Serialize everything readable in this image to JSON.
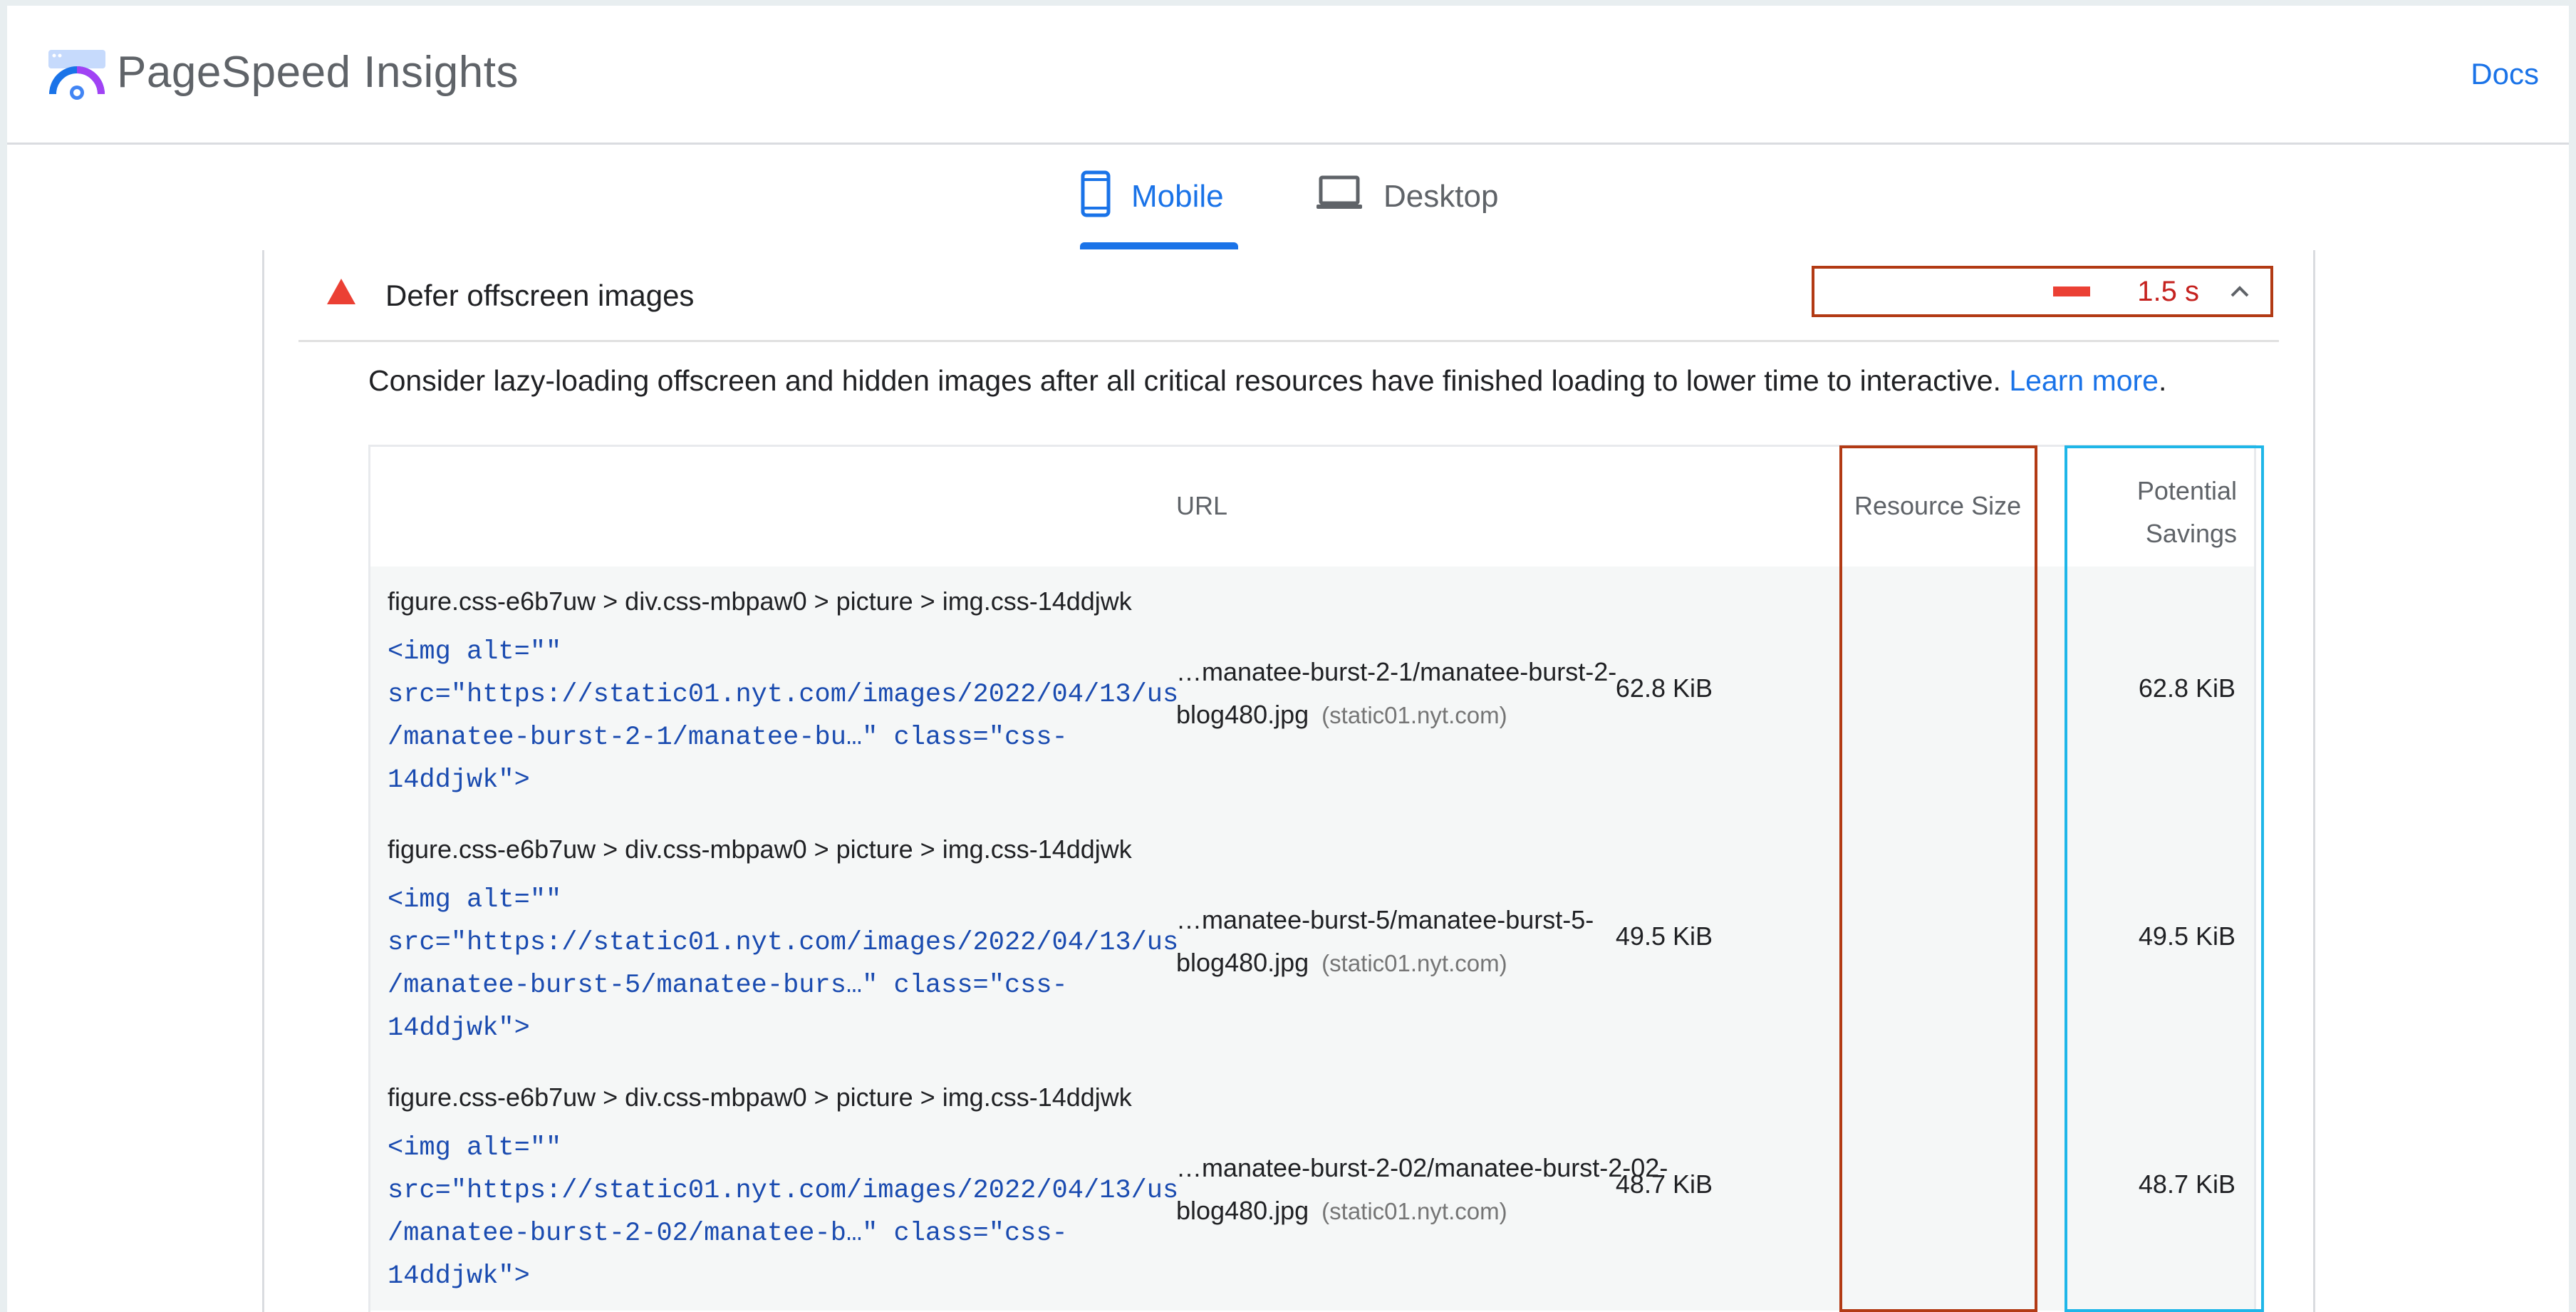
{
  "app": {
    "title": "PageSpeed Insights",
    "docs_label": "Docs",
    "logo_icon": "pagespeed-gauge-icon"
  },
  "tabs": [
    {
      "label": "Mobile",
      "icon": "phone-icon",
      "selected": true
    },
    {
      "label": "Desktop",
      "icon": "laptop-icon",
      "selected": false
    }
  ],
  "audit": {
    "title": "Defer offscreen images",
    "status_icon": "warning-triangle-icon",
    "metric_value": "1.5 s",
    "description": "Consider lazy-loading offscreen and hidden images after all critical resources have finished loading to lower time to interactive.",
    "learn_more": "Learn more",
    "description_end": "."
  },
  "table": {
    "headers": {
      "url": "URL",
      "resource_size": "Resource Size",
      "potential_savings_line1": "Potential",
      "potential_savings_line2": "Savings"
    },
    "rows": [
      {
        "node_label": "figure.css-e6b7uw > div.css-mbpaw0 > picture > img.css-14ddjwk",
        "snippet_lines": [
          "<img alt=\"\"",
          "src=\"https://static01.nyt.com/images/2022/04/13/us",
          "/manatee-burst-2-1/manatee-bu…\" class=\"css-",
          "14ddjwk\">"
        ],
        "url_line1": "…manatee-burst-2-1/manatee-burst-2-",
        "url_line2": "blog480.jpg",
        "url_host": "(static01.nyt.com)",
        "resource_size": "62.8 KiB",
        "potential_savings": "62.8 KiB"
      },
      {
        "node_label": "figure.css-e6b7uw > div.css-mbpaw0 > picture > img.css-14ddjwk",
        "snippet_lines": [
          "<img alt=\"\"",
          "src=\"https://static01.nyt.com/images/2022/04/13/us",
          "/manatee-burst-5/manatee-burs…\" class=\"css-",
          "14ddjwk\">"
        ],
        "url_line1": "…manatee-burst-5/manatee-burst-5-",
        "url_line2": "blog480.jpg",
        "url_host": "(static01.nyt.com)",
        "resource_size": "49.5 KiB",
        "potential_savings": "49.5 KiB"
      },
      {
        "node_label": "figure.css-e6b7uw > div.css-mbpaw0 > picture > img.css-14ddjwk",
        "snippet_lines": [
          "<img alt=\"\"",
          "src=\"https://static01.nyt.com/images/2022/04/13/us",
          "/manatee-burst-2-02/manatee-b…\" class=\"css-",
          "14ddjwk\">"
        ],
        "url_line1": "…manatee-burst-2-02/manatee-burst-2-02-",
        "url_line2": "blog480.jpg",
        "url_host": "(static01.nyt.com)",
        "resource_size": "48.7 KiB",
        "potential_savings": "48.7 KiB"
      }
    ]
  },
  "colors": {
    "accent": "#1a73e8",
    "fail": "#eb4034",
    "highlight_resource_size": "#b23a14",
    "highlight_savings": "#1fb6e8"
  }
}
